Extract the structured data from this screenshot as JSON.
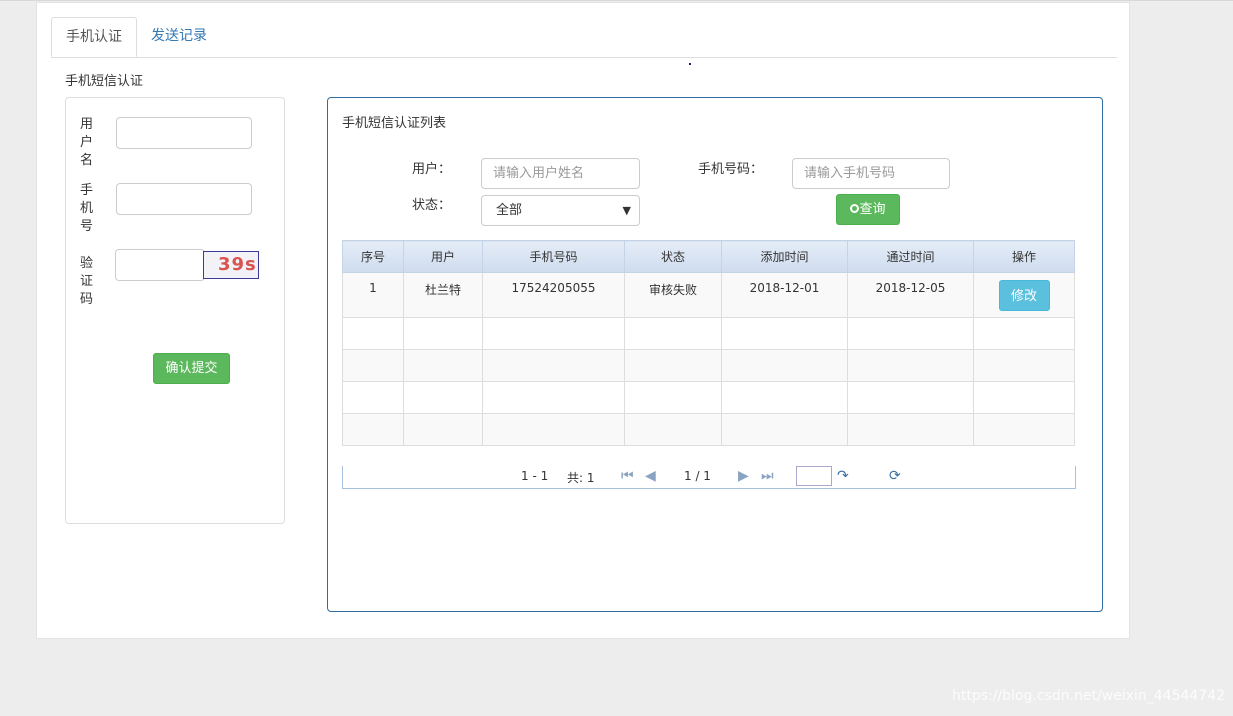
{
  "tabs": [
    {
      "label": "手机认证"
    },
    {
      "label": "发送记录"
    }
  ],
  "section_title": "手机短信认证",
  "form": {
    "username_label": [
      "用",
      "户",
      "名"
    ],
    "phone_label": [
      "手",
      "机",
      "号"
    ],
    "captcha_label": [
      "验",
      "证",
      "码"
    ],
    "captcha_text": "39s",
    "submit_label": "确认提交"
  },
  "list": {
    "title": "手机短信认证列表",
    "filters": {
      "user_label": "用户：",
      "user_placeholder": "请输入用户姓名",
      "phone_label": "手机号码：",
      "phone_placeholder": "请输入手机号码",
      "status_label": "状态：",
      "status_value": "全部",
      "query_label": "查询"
    },
    "columns": [
      "序号",
      "用户",
      "手机号码",
      "状态",
      "添加时间",
      "通过时间",
      "操作"
    ],
    "rows": [
      {
        "no": "1",
        "user": "杜兰特",
        "phone": "17524205055",
        "status": "审核失败",
        "added": "2018-12-01",
        "passed": "2018-12-05",
        "action": "修改"
      }
    ],
    "pager": {
      "range": "1 - 1",
      "total": "共: 1",
      "page": "1 / 1"
    }
  },
  "watermark": "https://blog.csdn.net/weixin_44544742"
}
